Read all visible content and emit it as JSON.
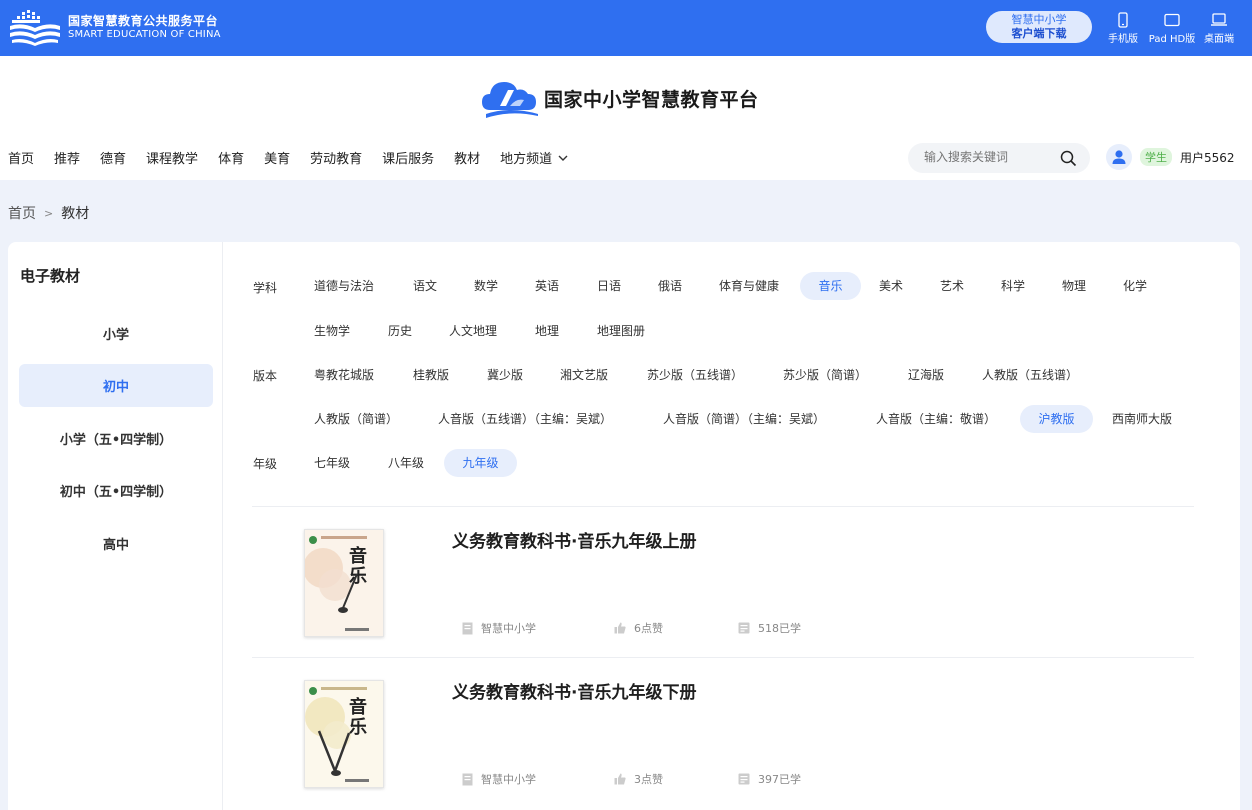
{
  "topbar": {
    "brand_cn": "国家智慧教育公共服务平台",
    "brand_en": "SMART EDUCATION OF CHINA",
    "download_line1": "智慧中小学",
    "download_line2": "客户端下载",
    "devices": [
      {
        "label": "手机版",
        "icon": "phone-icon"
      },
      {
        "label": "Pad HD版",
        "icon": "tablet-icon"
      },
      {
        "label": "桌面端",
        "icon": "laptop-icon"
      }
    ]
  },
  "header": {
    "site_title": "国家中小学智慧教育平台",
    "nav": [
      "首页",
      "推荐",
      "德育",
      "课程教学",
      "体育",
      "美育",
      "劳动教育",
      "课后服务",
      "教材",
      "地方频道"
    ],
    "search_placeholder": "输入搜索关键词",
    "user_role": "学生",
    "user_name": "用户5562"
  },
  "breadcrumb": {
    "home": "首页",
    "sep": ">",
    "current": "教材"
  },
  "sidebar": {
    "title": "电子教材",
    "items": [
      "小学",
      "初中",
      "小学（五•四学制）",
      "初中（五•四学制）",
      "高中"
    ],
    "active_index": 1
  },
  "filters": {
    "subject_label": "学科",
    "subjects": [
      "道德与法治",
      "语文",
      "数学",
      "英语",
      "日语",
      "俄语",
      "体育与健康",
      "音乐",
      "美术",
      "艺术",
      "科学",
      "物理",
      "化学",
      "生物学",
      "历史",
      "人文地理",
      "地理",
      "地理图册"
    ],
    "subject_active": "音乐",
    "edition_label": "版本",
    "editions": [
      "粤教花城版",
      "桂教版",
      "冀少版",
      "湘文艺版",
      "苏少版（五线谱）",
      "苏少版（简谱）",
      "辽海版",
      "人教版（五线谱）",
      "人教版（简谱）",
      "人音版（五线谱）（主编：吴斌）",
      "人音版（简谱）（主编：吴斌）",
      "人音版（主编：敬谱）",
      "沪教版",
      "西南师大版"
    ],
    "edition_active": "沪教版",
    "grade_label": "年级",
    "grades": [
      "七年级",
      "八年级",
      "九年级"
    ],
    "grade_active": "九年级"
  },
  "books": [
    {
      "title": "义务教育教科书·音乐九年级上册",
      "publisher": "智慧中小学",
      "likes": "6点赞",
      "learners": "518已学",
      "cover_text": "音乐",
      "cover_color": "#f6e6d6"
    },
    {
      "title": "义务教育教科书·音乐九年级下册",
      "publisher": "智慧中小学",
      "likes": "3点赞",
      "learners": "397已学",
      "cover_text": "音乐",
      "cover_color": "#f7f0d8"
    }
  ],
  "colors": {
    "primary": "#2f6ff0",
    "active_bg": "#e7eefc",
    "badge_green": "#4fb04a"
  }
}
